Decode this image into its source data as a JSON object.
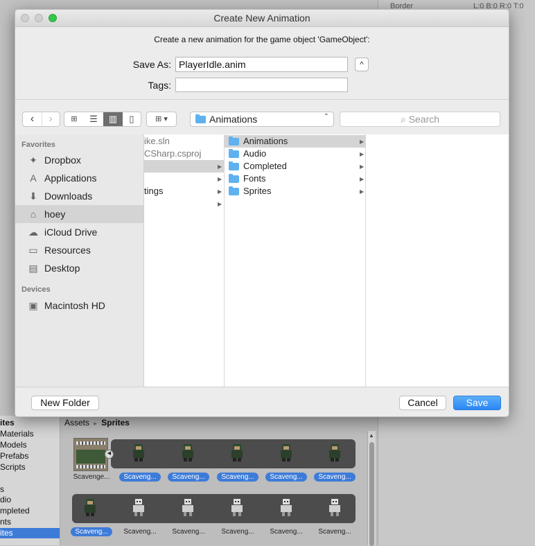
{
  "background": {
    "inspector": {
      "border_label": "Border",
      "border_values": "L:0 B:0 R:0 T:0"
    },
    "tree_items": [
      "ites",
      "Materials",
      "Models",
      "Prefabs",
      "Scripts",
      "s",
      "dio",
      "mpleted",
      "nts",
      "ites"
    ],
    "breadcrumb": {
      "root": "Assets",
      "sep": "▸",
      "leaf": "Sprites"
    },
    "assets_row1": [
      {
        "label": "Scavenge...",
        "selected": false
      },
      {
        "label": "Scaveng...",
        "selected": true
      },
      {
        "label": "Scaveng...",
        "selected": true
      },
      {
        "label": "Scaveng...",
        "selected": true
      },
      {
        "label": "Scaveng...",
        "selected": true
      },
      {
        "label": "Scaveng...",
        "selected": true
      }
    ],
    "assets_row2": [
      {
        "label": "Scaveng...",
        "selected": true
      },
      {
        "label": "Scaveng...",
        "selected": false
      },
      {
        "label": "Scaveng...",
        "selected": false
      },
      {
        "label": "Scaveng...",
        "selected": false
      },
      {
        "label": "Scaveng...",
        "selected": false
      },
      {
        "label": "Scaveng...",
        "selected": false
      }
    ]
  },
  "dialog": {
    "title": "Create New Animation",
    "prompt": "Create a new animation for the game object 'GameObject':",
    "save_as_label": "Save As:",
    "save_as_value": "PlayerIdle.anim",
    "tags_label": "Tags:",
    "tags_value": "",
    "location": "Animations",
    "search_placeholder": "Search",
    "sidebar": {
      "favorites_header": "Favorites",
      "favorites": [
        "Dropbox",
        "Applications",
        "Downloads",
        "hoey",
        "iCloud Drive",
        "Resources",
        "Desktop"
      ],
      "selected": "hoey",
      "devices_header": "Devices",
      "devices": [
        "Macintosh HD"
      ]
    },
    "col1": [
      "ike.sln",
      "CSharp.csproj",
      "",
      "",
      "tings",
      ""
    ],
    "col2": [
      "Animations",
      "Audio",
      "Completed",
      "Fonts",
      "Sprites"
    ],
    "buttons": {
      "new_folder": "New Folder",
      "cancel": "Cancel",
      "save": "Save"
    }
  }
}
